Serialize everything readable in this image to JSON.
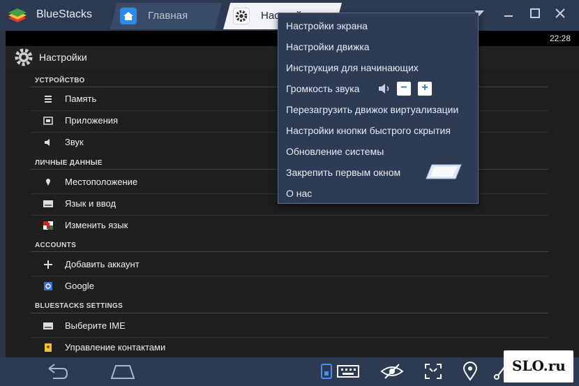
{
  "titlebar": {
    "app_title": "BlueStacks",
    "tabs": [
      {
        "label": "Главная",
        "icon": "home-icon"
      },
      {
        "label": "Настройки",
        "icon": "gear-icon"
      }
    ],
    "window_buttons": [
      "minimize-icon",
      "maximize-icon",
      "close-icon"
    ]
  },
  "status": {
    "clock": "22:28"
  },
  "settings": {
    "title": "Настройки",
    "sections": [
      {
        "header": "УСТРОЙСТВО",
        "items": [
          {
            "label": "Память",
            "icon": "storage-icon"
          },
          {
            "label": "Приложения",
            "icon": "apps-icon"
          },
          {
            "label": "Звук",
            "icon": "sound-icon"
          }
        ]
      },
      {
        "header": "ЛИЧНЫЕ ДАННЫЕ",
        "items": [
          {
            "label": "Местоположение",
            "icon": "location-icon"
          },
          {
            "label": "Язык и ввод",
            "icon": "keyboard-icon"
          },
          {
            "label": "Изменить язык",
            "icon": "language-icon"
          }
        ]
      },
      {
        "header": "ACCOUNTS",
        "items": [
          {
            "label": "Добавить аккаунт",
            "icon": "plus-icon"
          },
          {
            "label": "Google",
            "icon": "google-icon"
          }
        ]
      },
      {
        "header": "BLUESTACKS SETTINGS",
        "items": [
          {
            "label": "Выберите IME",
            "icon": "keyboard-icon"
          },
          {
            "label": "Управление контактами",
            "icon": "contacts-icon"
          }
        ]
      }
    ]
  },
  "menu": {
    "items": [
      "Настройки экрана",
      "Настройки движка",
      "Инструкция для начинающих",
      "Громкость звука",
      "Перезагрузить движок виртуализации",
      "Настройки кнопки быстрого скрытия",
      "Обновление системы",
      "Закрепить первым окном",
      "О нас"
    ],
    "volume_minus": "−",
    "volume_plus": "+"
  },
  "watermark": {
    "text": "SLO.ru"
  },
  "colors": {
    "titlebar": "#2c3a52",
    "menu_bg": "#2e3b55",
    "accent": "#2d8ae6",
    "list_bg": "#1f1f1f"
  }
}
